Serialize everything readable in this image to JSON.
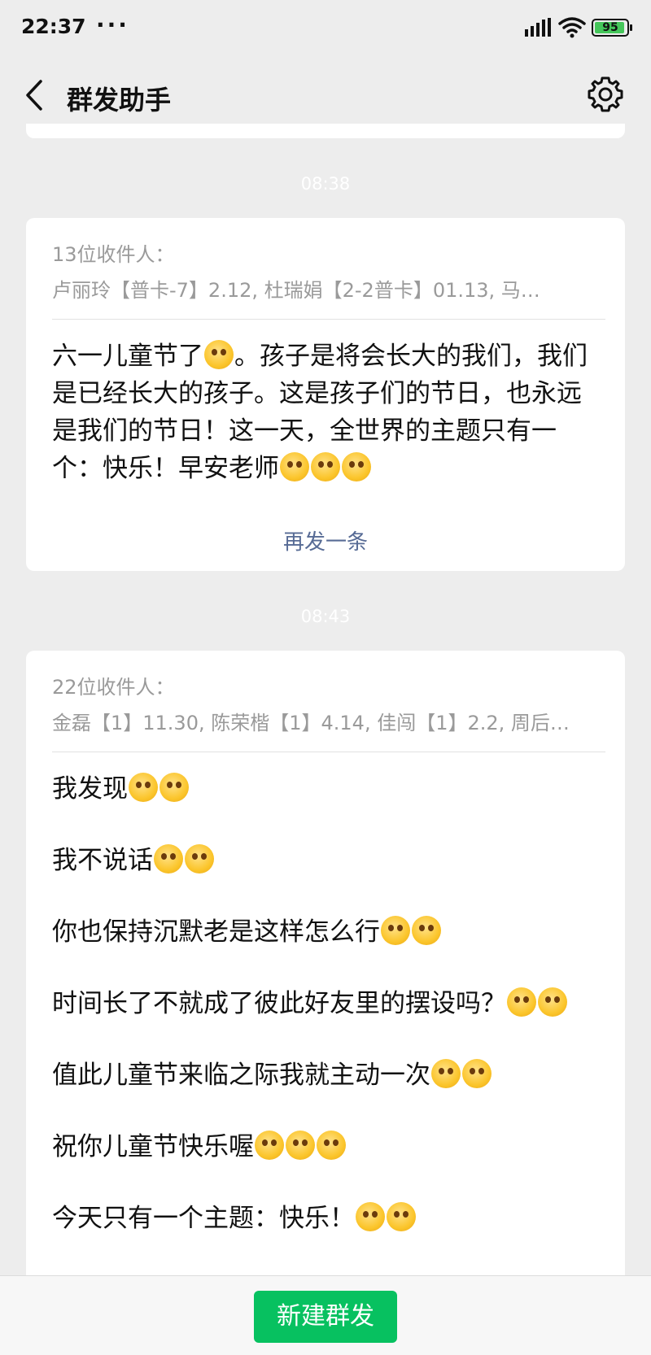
{
  "status_bar": {
    "time": "22:37",
    "dots": "···",
    "signal_icon": "signal-icon",
    "wifi_icon": "wifi-icon",
    "battery_level": "95"
  },
  "nav": {
    "title": "群发助手",
    "back_icon": "back-chevron-icon",
    "settings_icon": "gear-icon"
  },
  "messages": [
    {
      "time": "08:38",
      "recipient_count": "13位收件人：",
      "recipients": "卢丽玲【普卡-7】2.12, 杜瑞娟【2-2普卡】01.13, 马…",
      "body_parts": [
        "六一儿童节了",
        "。孩子是将会长大的我们，我们是已经长大的孩子。这是孩子们的节日，也永远是我们的节日！这一天，全世界的主题只有一个：快乐！早安老师"
      ],
      "resend_label": "再发一条"
    },
    {
      "time": "08:43",
      "recipient_count": "22位收件人：",
      "recipients": "金磊【1】11.30, 陈荣楷【1】4.14, 佳闯【1】2.2, 周后…",
      "paragraphs": [
        "我发现",
        "我不说话",
        "你也保持沉默老是这样怎么行",
        "时间长了不就成了彼此好友里的摆设吗？",
        "值此儿童节来临之际我就主动一次",
        "祝你儿童节快乐喔",
        "今天只有一个主题：快乐！"
      ]
    }
  ],
  "bottom": {
    "new_button_label": "新建群发"
  },
  "colors": {
    "accent_green": "#07c160",
    "link_blue": "#576b95",
    "background": "#ededed"
  }
}
